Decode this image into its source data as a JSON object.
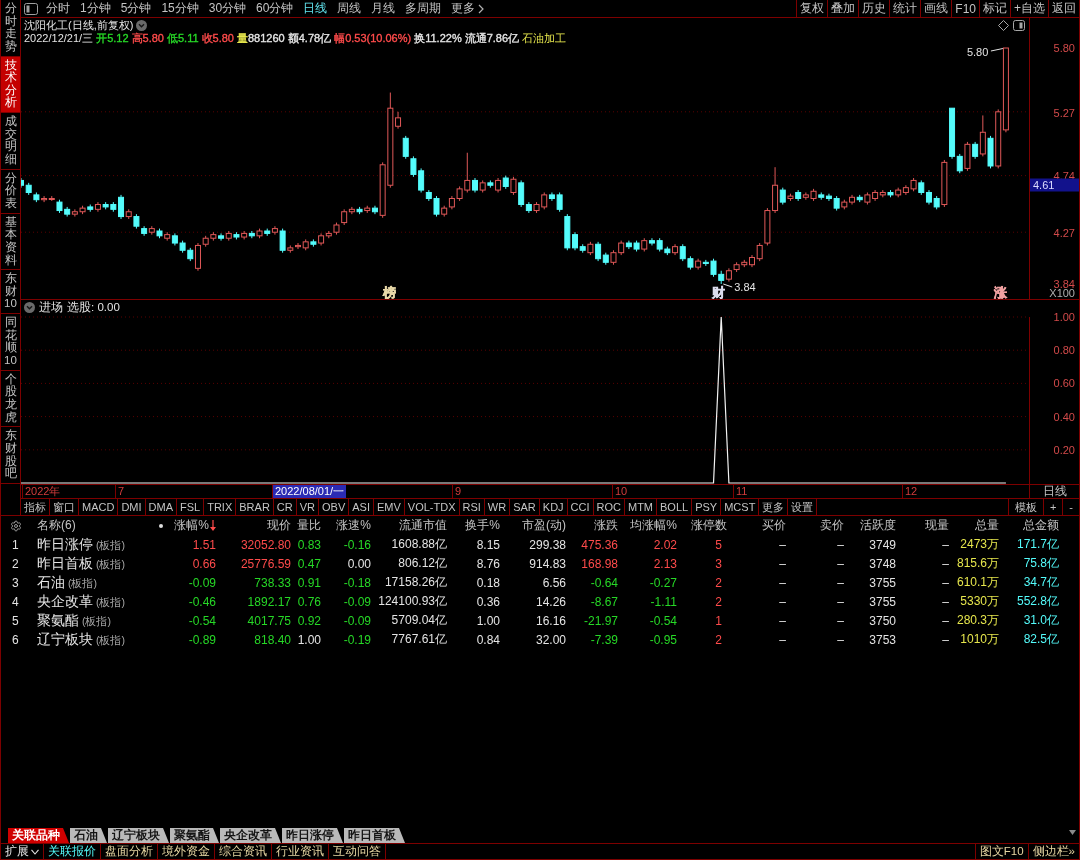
{
  "sidebar": {
    "tabs": [
      {
        "label": "分时走势",
        "selected": false
      },
      {
        "label": "技术分析",
        "selected": true
      },
      {
        "label": "成交明细",
        "selected": false
      },
      {
        "label": "分价表",
        "selected": false
      },
      {
        "label": "基本资料",
        "selected": false
      },
      {
        "label": "东财10",
        "selected": false
      },
      {
        "label": "同花顺10",
        "selected": false
      },
      {
        "label": "个股龙虎",
        "selected": false
      },
      {
        "label": "东财股吧",
        "selected": false
      }
    ]
  },
  "toolbar": {
    "periods": [
      {
        "label": "分时",
        "kind": "period",
        "selected": false
      },
      {
        "label": "1分钟",
        "kind": "period",
        "selected": false
      },
      {
        "label": "5分钟",
        "kind": "period",
        "selected": false
      },
      {
        "label": "15分钟",
        "kind": "period",
        "selected": false
      },
      {
        "label": "30分钟",
        "kind": "period",
        "selected": false
      },
      {
        "label": "60分钟",
        "kind": "period",
        "selected": false
      },
      {
        "label": "日线",
        "kind": "period",
        "selected": true
      },
      {
        "label": "周线",
        "kind": "period",
        "selected": false
      },
      {
        "label": "月线",
        "kind": "period",
        "selected": false
      },
      {
        "label": "多周期",
        "kind": "period",
        "selected": false
      },
      {
        "label": "更多",
        "kind": "menu",
        "selected": false
      }
    ],
    "buttons": [
      "复权",
      "叠加",
      "历史",
      "统计",
      "画线",
      "F10",
      "标记",
      "+自选",
      "返回"
    ]
  },
  "price_chart": {
    "title": "沈阳化工(日线,前复权)",
    "date": "2022/12/21/三",
    "fields": [
      {
        "label": "开",
        "value": "5.12",
        "kind": "plain",
        "color": "#26d826"
      },
      {
        "label": "高",
        "value": "5.80",
        "kind": "plain",
        "color": "#ff4b4b"
      },
      {
        "label": "低",
        "value": "5.11",
        "kind": "plain",
        "color": "#26d826"
      },
      {
        "label": "收",
        "value": "5.80",
        "kind": "plain",
        "color": "#ff4b4b"
      },
      {
        "label": "量",
        "value": "881260",
        "kind": "volume"
      },
      {
        "label": "额",
        "value": "4.78亿",
        "kind": "plain"
      },
      {
        "label": "幅",
        "value": "0.53(10.06%)",
        "kind": "plain",
        "color": "#ff4b4b"
      },
      {
        "label": "换",
        "value": "11.22%",
        "kind": "plain"
      },
      {
        "label": "流通",
        "value": "7.86亿",
        "kind": "plain"
      }
    ],
    "sector": "石油加工",
    "high_label": "5.80",
    "low_label": "3.84",
    "markers": [
      {
        "label": "榜",
        "color": "#e8d8a8"
      },
      {
        "label": "财",
        "color": "#dcdcec"
      },
      {
        "label": "涨",
        "color": "#f0a0a0"
      }
    ],
    "axis": [
      "5.80",
      "5.27",
      "4.74",
      "4.27",
      "3.84"
    ],
    "current_price": "4.61",
    "scale": "X100"
  },
  "indicator": {
    "name": "进场",
    "output": "选股: 0.00",
    "chart_data": {
      "type": "line",
      "values": [
        0,
        0,
        0,
        0,
        0,
        0,
        0,
        0,
        0,
        0,
        0,
        0,
        0,
        0,
        0,
        0,
        0,
        0,
        0,
        0,
        0,
        0,
        0,
        0,
        0,
        0,
        0,
        0,
        0,
        0,
        0,
        0,
        0,
        0,
        0,
        0,
        0,
        0,
        0,
        0,
        0,
        0,
        0,
        0,
        0,
        0,
        0,
        0,
        0,
        0,
        0,
        0,
        0,
        0,
        0,
        0,
        0,
        0,
        0,
        0,
        0,
        0,
        0,
        0,
        0,
        0,
        0,
        0,
        0,
        0,
        0,
        0,
        0,
        0,
        0,
        0,
        0,
        0,
        0,
        0,
        0,
        0,
        0,
        0,
        0,
        0,
        0,
        0,
        0,
        0,
        0,
        1,
        0,
        0,
        0,
        0,
        0,
        0,
        0,
        0,
        0,
        0,
        0,
        0,
        0,
        0,
        0,
        0,
        0,
        0,
        0,
        0,
        0,
        0,
        0,
        0,
        0,
        0,
        0,
        0,
        0,
        0,
        0,
        0,
        0,
        0,
        0,
        0,
        0,
        null,
        null,
        null
      ],
      "ylim": [
        0,
        1
      ],
      "yticks": [
        {
          "value": 0.2,
          "label": "0.20"
        },
        {
          "value": 0.4,
          "label": "0.40"
        },
        {
          "value": 0.6,
          "label": "0.60"
        },
        {
          "value": 0.8,
          "label": "0.80"
        },
        {
          "value": 1,
          "label": "1.00"
        }
      ],
      "grid": true
    }
  },
  "date_axis": {
    "labels": [
      {
        "label": "2022年",
        "kind": "tick"
      },
      {
        "label": "7",
        "kind": "tick"
      },
      {
        "label": "2022/08/01/一",
        "kind": "cursor"
      },
      {
        "label": "9",
        "kind": "tick"
      },
      {
        "label": "10",
        "kind": "tick"
      },
      {
        "label": "11",
        "kind": "tick"
      },
      {
        "label": "12",
        "kind": "tick"
      }
    ],
    "period": "日线"
  },
  "indicator_tabs": {
    "tabs": [
      "指标",
      "窗口",
      "MACD",
      "DMI",
      "DMA",
      "FSL",
      "TRIX",
      "BRAR",
      "CR",
      "VR",
      "OBV",
      "ASI",
      "EMV",
      "VOL-TDX",
      "RSI",
      "WR",
      "SAR",
      "KDJ",
      "CCI",
      "ROC",
      "MTM",
      "BOLL",
      "PSY",
      "MCST",
      "更多",
      "设置"
    ],
    "tools": [
      "模板",
      "+",
      "-"
    ]
  },
  "table": {
    "columns": [
      {
        "label": "名称(6)",
        "sorted": false
      },
      {
        "label": "涨幅%",
        "sorted": true
      },
      {
        "label": "现价",
        "sorted": false
      },
      {
        "label": "量比",
        "sorted": false
      },
      {
        "label": "涨速%",
        "sorted": false
      },
      {
        "label": "流通市值",
        "sorted": false
      },
      {
        "label": "换手%",
        "sorted": false
      },
      {
        "label": "市盈(动)",
        "sorted": false
      },
      {
        "label": "涨跌",
        "sorted": false
      },
      {
        "label": "均涨幅%",
        "sorted": false
      },
      {
        "label": "涨停数",
        "sorted": false
      },
      {
        "label": "买价",
        "sorted": false
      },
      {
        "label": "卖价",
        "sorted": false
      },
      {
        "label": "活跃度",
        "sorted": false
      },
      {
        "label": "现量",
        "sorted": false
      },
      {
        "label": "总量",
        "sorted": false
      },
      {
        "label": "总金额",
        "sorted": false
      }
    ],
    "rows": [
      {
        "index": "1",
        "cells": [
          {
            "text": "昨日涨停",
            "tag": "(板指)"
          },
          {
            "text": "1.51",
            "color": "#ff4b4b"
          },
          {
            "text": "32052.80",
            "color": "#ff4b4b"
          },
          {
            "text": "0.83",
            "color": "#26d826"
          },
          {
            "text": "-0.16",
            "color": "#26d826"
          },
          {
            "text": "1608.88亿"
          },
          {
            "text": "8.15"
          },
          {
            "text": "299.38"
          },
          {
            "text": "475.36",
            "color": "#ff4b4b"
          },
          {
            "text": "2.02",
            "color": "#ff4b4b"
          },
          {
            "text": "5",
            "color": "#ff4b4b"
          },
          {
            "text": "–"
          },
          {
            "text": "–"
          },
          {
            "text": "3749"
          },
          {
            "text": "–"
          },
          {
            "text": "2473万",
            "color": "#e6e64c"
          },
          {
            "text": "171.7亿",
            "color": "#54fcfc"
          }
        ]
      },
      {
        "index": "2",
        "cells": [
          {
            "text": "昨日首板",
            "tag": "(板指)"
          },
          {
            "text": "0.66",
            "color": "#ff4b4b"
          },
          {
            "text": "25776.59",
            "color": "#ff4b4b"
          },
          {
            "text": "0.47",
            "color": "#26d826"
          },
          {
            "text": "0.00"
          },
          {
            "text": "806.12亿"
          },
          {
            "text": "8.76"
          },
          {
            "text": "914.83"
          },
          {
            "text": "168.98",
            "color": "#ff4b4b"
          },
          {
            "text": "2.13",
            "color": "#ff4b4b"
          },
          {
            "text": "3",
            "color": "#ff4b4b"
          },
          {
            "text": "–"
          },
          {
            "text": "–"
          },
          {
            "text": "3748"
          },
          {
            "text": "–"
          },
          {
            "text": "815.6万",
            "color": "#e6e64c"
          },
          {
            "text": "75.8亿",
            "color": "#54fcfc"
          }
        ]
      },
      {
        "index": "3",
        "cells": [
          {
            "text": "石油",
            "tag": "(板指)"
          },
          {
            "text": "-0.09",
            "color": "#26d826"
          },
          {
            "text": "738.33",
            "color": "#26d826"
          },
          {
            "text": "0.91",
            "color": "#26d826"
          },
          {
            "text": "-0.18",
            "color": "#26d826"
          },
          {
            "text": "17158.26亿"
          },
          {
            "text": "0.18"
          },
          {
            "text": "6.56"
          },
          {
            "text": "-0.64",
            "color": "#26d826"
          },
          {
            "text": "-0.27",
            "color": "#26d826"
          },
          {
            "text": "2",
            "color": "#ff4b4b"
          },
          {
            "text": "–"
          },
          {
            "text": "–"
          },
          {
            "text": "3755"
          },
          {
            "text": "–"
          },
          {
            "text": "610.1万",
            "color": "#e6e64c"
          },
          {
            "text": "34.7亿",
            "color": "#54fcfc"
          }
        ]
      },
      {
        "index": "4",
        "cells": [
          {
            "text": "央企改革",
            "tag": "(板指)"
          },
          {
            "text": "-0.46",
            "color": "#26d826"
          },
          {
            "text": "1892.17",
            "color": "#26d826"
          },
          {
            "text": "0.76",
            "color": "#26d826"
          },
          {
            "text": "-0.09",
            "color": "#26d826"
          },
          {
            "text": "124100.93亿"
          },
          {
            "text": "0.36"
          },
          {
            "text": "14.26"
          },
          {
            "text": "-8.67",
            "color": "#26d826"
          },
          {
            "text": "-1.11",
            "color": "#26d826"
          },
          {
            "text": "2",
            "color": "#ff4b4b"
          },
          {
            "text": "–"
          },
          {
            "text": "–"
          },
          {
            "text": "3755"
          },
          {
            "text": "–"
          },
          {
            "text": "5330万",
            "color": "#e6e64c"
          },
          {
            "text": "552.8亿",
            "color": "#54fcfc"
          }
        ]
      },
      {
        "index": "5",
        "cells": [
          {
            "text": "聚氨酯",
            "tag": "(板指)"
          },
          {
            "text": "-0.54",
            "color": "#26d826"
          },
          {
            "text": "4017.75",
            "color": "#26d826"
          },
          {
            "text": "0.92",
            "color": "#26d826"
          },
          {
            "text": "-0.09",
            "color": "#26d826"
          },
          {
            "text": "5709.04亿"
          },
          {
            "text": "1.00"
          },
          {
            "text": "16.16"
          },
          {
            "text": "-21.97",
            "color": "#26d826"
          },
          {
            "text": "-0.54",
            "color": "#26d826"
          },
          {
            "text": "1",
            "color": "#ff4b4b"
          },
          {
            "text": "–"
          },
          {
            "text": "–"
          },
          {
            "text": "3750"
          },
          {
            "text": "–"
          },
          {
            "text": "280.3万",
            "color": "#e6e64c"
          },
          {
            "text": "31.0亿",
            "color": "#54fcfc"
          }
        ]
      },
      {
        "index": "6",
        "cells": [
          {
            "text": "辽宁板块",
            "tag": "(板指)"
          },
          {
            "text": "-0.89",
            "color": "#26d826"
          },
          {
            "text": "818.40",
            "color": "#26d826"
          },
          {
            "text": "1.00"
          },
          {
            "text": "-0.19",
            "color": "#26d826"
          },
          {
            "text": "7767.61亿"
          },
          {
            "text": "0.84"
          },
          {
            "text": "32.00"
          },
          {
            "text": "-7.39",
            "color": "#26d826"
          },
          {
            "text": "-0.95",
            "color": "#26d826"
          },
          {
            "text": "2",
            "color": "#ff4b4b"
          },
          {
            "text": "–"
          },
          {
            "text": "–"
          },
          {
            "text": "3753"
          },
          {
            "text": "–"
          },
          {
            "text": "1010万",
            "color": "#e6e64c"
          },
          {
            "text": "82.5亿",
            "color": "#54fcfc"
          }
        ]
      }
    ]
  },
  "bottom_tabs": [
    {
      "label": "关联品种",
      "selected": true
    },
    {
      "label": "石油",
      "selected": false
    },
    {
      "label": "辽宁板块",
      "selected": false
    },
    {
      "label": "聚氨酯",
      "selected": false
    },
    {
      "label": "央企改革",
      "selected": false
    },
    {
      "label": "昨日涨停",
      "selected": false
    },
    {
      "label": "昨日首板",
      "selected": false
    }
  ],
  "status_bar": {
    "items": [
      {
        "label": "扩展",
        "kind": "menu",
        "selected": false
      },
      {
        "label": "关联报价",
        "kind": "link",
        "selected": true
      },
      {
        "label": "盘面分析",
        "kind": "link",
        "selected": false
      },
      {
        "label": "境外资金",
        "kind": "link",
        "selected": false
      },
      {
        "label": "综合资讯",
        "kind": "link",
        "selected": false
      },
      {
        "label": "行业资讯",
        "kind": "link",
        "selected": false
      },
      {
        "label": "互动问答",
        "kind": "link",
        "selected": false
      }
    ],
    "right": [
      "图文F10",
      "侧边栏»"
    ]
  }
}
